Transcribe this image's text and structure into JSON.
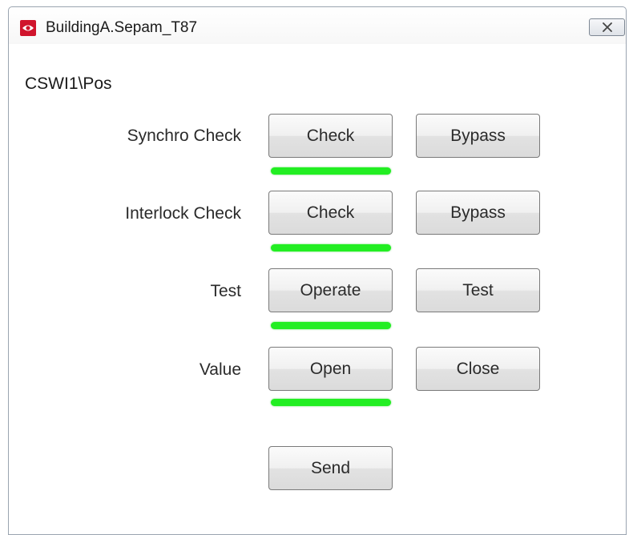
{
  "window": {
    "title": "BuildingA.Sepam_T87",
    "app_icon": "app-logo-icon",
    "close_icon": "close-icon"
  },
  "path_label": "CSWI1\\Pos",
  "colors": {
    "indicator": "#22ee22",
    "app_icon_bg": "#d0142c"
  },
  "rows": [
    {
      "label": "Synchro Check",
      "primary": "Check",
      "secondary": "Bypass",
      "indicator_active": true
    },
    {
      "label": "Interlock Check",
      "primary": "Check",
      "secondary": "Bypass",
      "indicator_active": true
    },
    {
      "label": "Test",
      "primary": "Operate",
      "secondary": "Test",
      "indicator_active": true
    },
    {
      "label": "Value",
      "primary": "Open",
      "secondary": "Close",
      "indicator_active": true
    }
  ],
  "send_button": "Send"
}
